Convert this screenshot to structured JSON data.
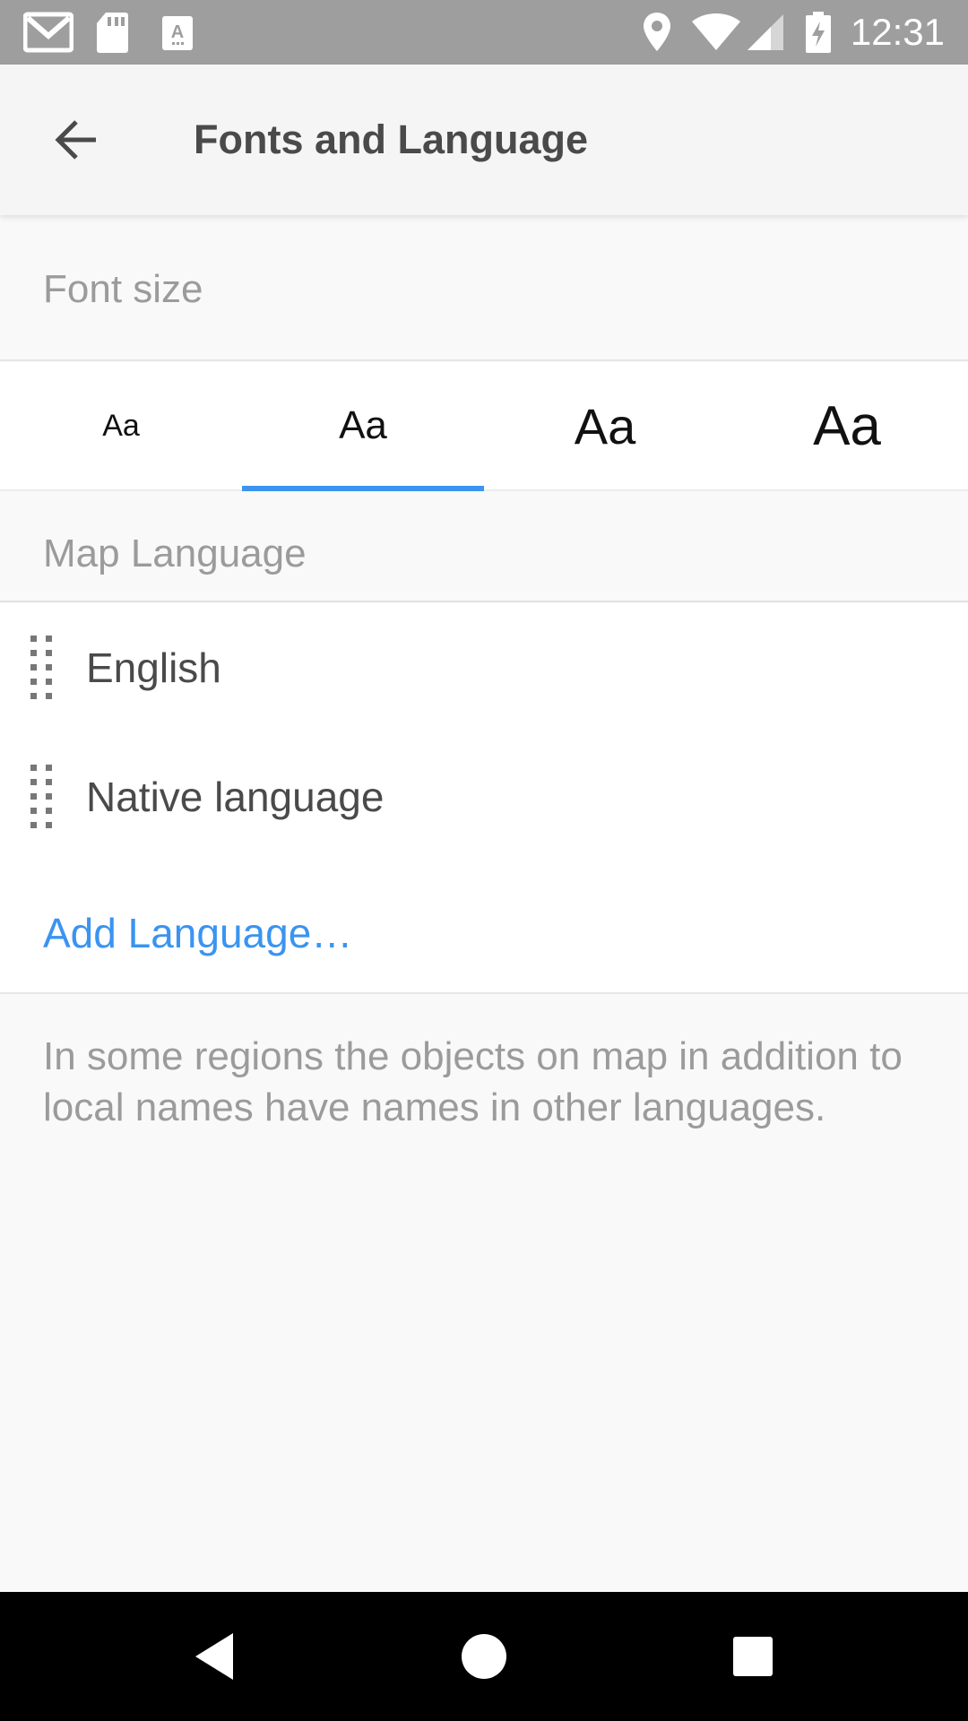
{
  "status_bar": {
    "time": "12:31",
    "left_icons": [
      "gmail-icon",
      "sd-card-icon",
      "text-app-icon"
    ],
    "right_icons": [
      "location-icon",
      "wifi-icon",
      "cell-signal-icon",
      "battery-charging-icon"
    ]
  },
  "app_bar": {
    "back_icon": "arrow-back-icon",
    "title": "Fonts and Language"
  },
  "font_size": {
    "header": "Font size",
    "options": [
      {
        "label": "Aa",
        "selected": false
      },
      {
        "label": "Aa",
        "selected": true
      },
      {
        "label": "Aa",
        "selected": false
      },
      {
        "label": "Aa",
        "selected": false
      }
    ],
    "accent_color": "#3a94f0"
  },
  "map_language": {
    "header": "Map Language",
    "items": [
      {
        "label": "English",
        "icon": "drag-handle-icon"
      },
      {
        "label": "Native language",
        "icon": "drag-handle-icon"
      }
    ],
    "add_label": "Add Language…",
    "link_color": "#3a94f0"
  },
  "note": "In some regions the objects on map in addition to local names have names in other languages.",
  "nav_bar": {
    "icons": [
      "back-triangle-icon",
      "home-circle-icon",
      "recents-square-icon"
    ]
  }
}
